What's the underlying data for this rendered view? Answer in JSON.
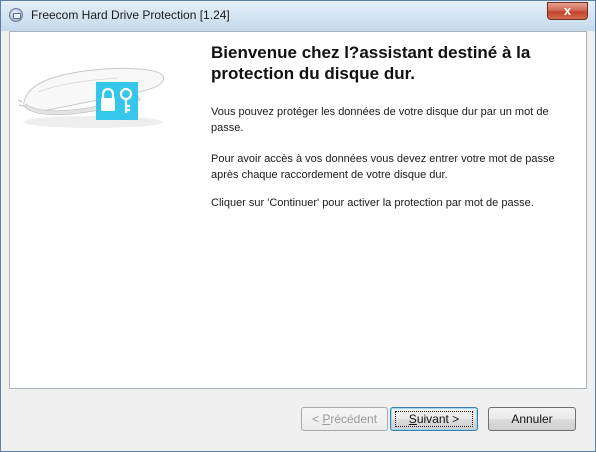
{
  "window": {
    "title": "Freecom Hard Drive Protection [1.24]",
    "close_label": "x"
  },
  "content": {
    "heading": "Bienvenue chez l?assistant destiné à la protection du disque dur.",
    "paragraphs": [
      "Vous pouvez protéger les données de votre disque dur par un mot de passe.",
      "Pour avoir accès à vos données vous devez entrer votre mot de passe après chaque raccordement de votre disque dur.",
      "Cliquer sur 'Continuer' pour activer la protection par mot de passe."
    ]
  },
  "buttons": {
    "prev": {
      "label_underlined": "P",
      "label_before": "< ",
      "label_after": "récédent",
      "enabled": false
    },
    "next": {
      "label_underlined": "S",
      "label_before": "",
      "label_after": "uivant >",
      "enabled": true
    },
    "cancel": {
      "label": "Annuler",
      "enabled": true
    }
  },
  "colors": {
    "lock_badge": "#35c6ea",
    "close_button": "#c1442c",
    "titlebar": "#d6e5f3"
  }
}
